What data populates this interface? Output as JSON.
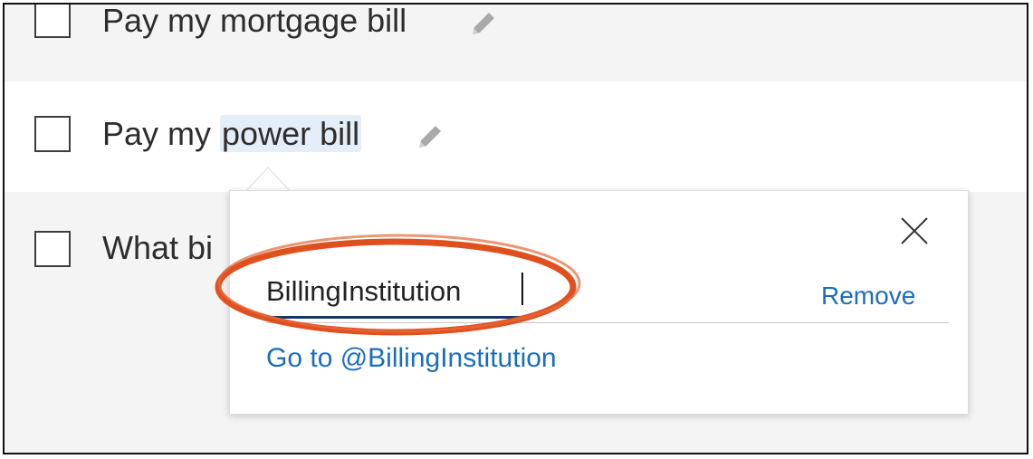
{
  "todos": [
    {
      "prefix": "Pay my mortgage bill",
      "highlight": ""
    },
    {
      "prefix": "Pay my ",
      "highlight": "power bill"
    },
    {
      "prefix": "What bi",
      "highlight": ""
    }
  ],
  "popover": {
    "input_value": "BillingInstitution",
    "remove_label": "Remove",
    "goto_label": "Go to @BillingInstitution",
    "close_icon": "close-icon"
  },
  "icons": {
    "edit": "pencil-icon",
    "close": "close-icon"
  },
  "colors": {
    "link": "#1b6dbf",
    "highlight_bg": "#e3eef8",
    "annotation": "#e0501f",
    "input_underline": "#0f3a66"
  }
}
